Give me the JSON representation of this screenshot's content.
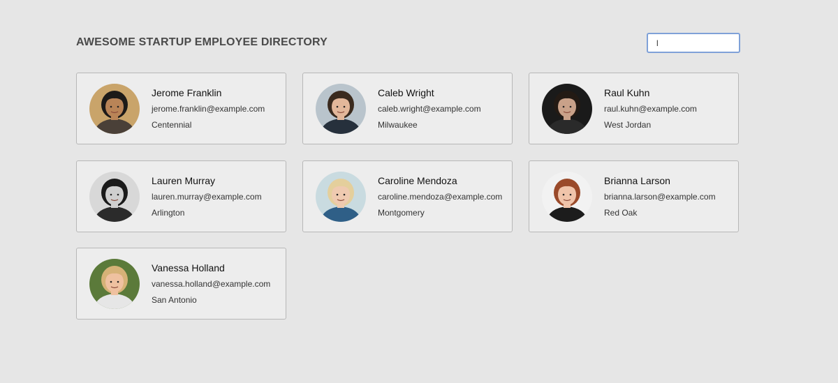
{
  "header": {
    "title": "AWESOME STARTUP EMPLOYEE DIRECTORY",
    "search_value": "l"
  },
  "employees": [
    {
      "name": "Jerome Franklin",
      "email": "jerome.franklin@example.com",
      "city": "Centennial",
      "bg": "#c9a46a",
      "skin": "#b98457",
      "hair": "#1c1a18",
      "shirt": "#4a4038"
    },
    {
      "name": "Caleb Wright",
      "email": "caleb.wright@example.com",
      "city": "Milwaukee",
      "bg": "#b9c4cc",
      "skin": "#e3b79a",
      "hair": "#3a2a1e",
      "shirt": "#26303c"
    },
    {
      "name": "Raul Kuhn",
      "email": "raul.kuhn@example.com",
      "city": "West Jordan",
      "bg": "#1a1a1a",
      "skin": "#c9a189",
      "hair": "#231a14",
      "shirt": "#2a2a2a"
    },
    {
      "name": "Lauren Murray",
      "email": "lauren.murray@example.com",
      "city": "Arlington",
      "bg": "#d8d8d8",
      "skin": "#cfcfcf",
      "hair": "#1a1a1a",
      "shirt": "#2b2b2b"
    },
    {
      "name": "Caroline Mendoza",
      "email": "caroline.mendoza@example.com",
      "city": "Montgomery",
      "bg": "#c9dbe0",
      "skin": "#efcab0",
      "hair": "#e4cf9c",
      "shirt": "#2f5f87"
    },
    {
      "name": "Brianna Larson",
      "email": "brianna.larson@example.com",
      "city": "Red Oak",
      "bg": "#f2f2f2",
      "skin": "#f0c4aa",
      "hair": "#9a4a2a",
      "shirt": "#1c1c1c"
    },
    {
      "name": "Vanessa Holland",
      "email": "vanessa.holland@example.com",
      "city": "San Antonio",
      "bg": "#5b7a3a",
      "skin": "#efc1a0",
      "hair": "#d6b277",
      "shirt": "#e6e6e6"
    }
  ]
}
